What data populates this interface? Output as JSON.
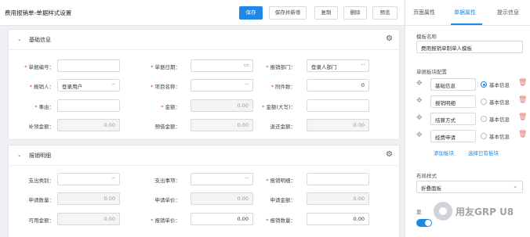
{
  "topbar": {
    "title": "费用报销单-单据样式设置",
    "save": "保存",
    "save_new": "保存并新增",
    "copy": "复制",
    "delete": "删除",
    "preview": "预览"
  },
  "section_basic": {
    "title": "基础信息",
    "fields": [
      {
        "label": "单据编号：",
        "required": true,
        "value": "",
        "kind": "text"
      },
      {
        "label": "单据日期：",
        "required": true,
        "value": "",
        "kind": "date"
      },
      {
        "label": "报销部门：",
        "required": true,
        "value": "登录人部门",
        "kind": "ellipsis"
      },
      {
        "label": "报销人：",
        "required": true,
        "value": "登录用户",
        "kind": "ellipsis"
      },
      {
        "label": "项目名称：",
        "required": true,
        "value": "",
        "kind": "ellipsis"
      },
      {
        "label": "附件数：",
        "required": true,
        "value": "0",
        "kind": "number"
      },
      {
        "label": "事由：",
        "required": true,
        "value": "",
        "kind": "text"
      },
      {
        "label": "金额：",
        "required": true,
        "value": "0.00",
        "kind": "disabled"
      },
      {
        "label": "金额(大写)：",
        "required": true,
        "value": "",
        "kind": "text"
      },
      {
        "label": "补领金额：",
        "required": false,
        "value": "0.00",
        "kind": "disabled"
      },
      {
        "label": "预借金额：",
        "required": false,
        "value": "0.00",
        "kind": "disabled"
      },
      {
        "label": "退还金额：",
        "required": false,
        "value": "0.00",
        "kind": "disabled"
      }
    ]
  },
  "section_detail": {
    "title": "报销明细",
    "fields": [
      {
        "label": "支出类别：",
        "required": false,
        "value": "",
        "kind": "ellipsis"
      },
      {
        "label": "支出事项：",
        "required": false,
        "value": "",
        "kind": "ellipsis"
      },
      {
        "label": "报销明细：",
        "required": true,
        "value": "",
        "kind": "text"
      },
      {
        "label": "申请数量：",
        "required": false,
        "value": "0.00",
        "kind": "disabled"
      },
      {
        "label": "申请单价：",
        "required": false,
        "value": "0.00",
        "kind": "disabled"
      },
      {
        "label": "申请金额：",
        "required": false,
        "value": "0.00",
        "kind": "disabled"
      },
      {
        "label": "可用金额：",
        "required": false,
        "value": "0.00",
        "kind": "disabled"
      },
      {
        "label": "报销单价：",
        "required": true,
        "value": "0.00",
        "kind": "number"
      },
      {
        "label": "报销数量：",
        "required": true,
        "value": "0.00",
        "kind": "number"
      }
    ]
  },
  "right_panel": {
    "tabs": [
      "页面属性",
      "单据属性",
      "提示信息"
    ],
    "template_name_label": "模板名称",
    "template_name_value": "费用报销单制单人模板",
    "block_config_label": "单据板块配置",
    "blocks": [
      {
        "name": "基础信息",
        "option": "基本信息",
        "selected": true
      },
      {
        "name": "报销明细",
        "option": "基本信息",
        "selected": false
      },
      {
        "name": "结算方式",
        "option": "基本信息",
        "selected": false
      },
      {
        "name": "经费申请",
        "option": "基本信息",
        "selected": false
      }
    ],
    "add_block": "添加板块",
    "choose_block": "选择已有板块",
    "layout_label": "布局样式",
    "layout_value": "折叠面板",
    "toggle_label": "显"
  },
  "watermark": "用友GRP U8",
  "accent_color": "#1e88e5"
}
